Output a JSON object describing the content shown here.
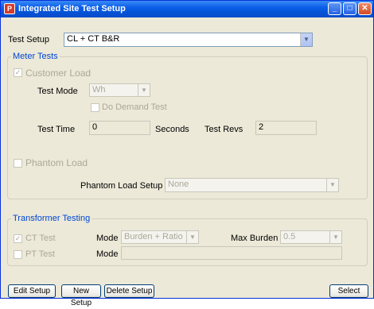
{
  "window": {
    "title": "Integrated Site Test Setup"
  },
  "titlebar": {
    "minimize": "_",
    "maximize": "□",
    "close": "✕",
    "app_icon": "P"
  },
  "test_setup": {
    "label": "Test Setup",
    "value": "CL + CT B&R"
  },
  "meter_tests": {
    "legend": "Meter Tests",
    "customer_load": {
      "label": "Customer Load",
      "checked": true
    },
    "test_mode": {
      "label": "Test Mode",
      "value": "Wh"
    },
    "do_demand_test": {
      "label": "Do Demand Test",
      "checked": false
    },
    "test_time": {
      "label": "Test Time",
      "value": "0",
      "unit": "Seconds"
    },
    "test_revs": {
      "label": "Test Revs",
      "value": "2"
    },
    "phantom_load": {
      "label": "Phantom Load",
      "checked": false
    },
    "phantom_load_setup": {
      "label": "Phantom Load Setup",
      "value": "None"
    }
  },
  "transformer_testing": {
    "legend": "Transformer Testing",
    "ct_test": {
      "label": "CT Test",
      "checked": true,
      "mode_label": "Mode",
      "mode_value": "Burden + Ratio",
      "max_burden_label": "Max Burden",
      "max_burden_value": "0.5"
    },
    "pt_test": {
      "label": "PT Test",
      "checked": false,
      "mode_label": "Mode",
      "mode_value": ""
    }
  },
  "buttons": {
    "edit_setup": "Edit Setup",
    "new_setup": "New Setup",
    "delete_setup": "Delete Setup",
    "select": "Select"
  },
  "icons": {
    "checkmark": "✓",
    "dropdown": "▼"
  }
}
